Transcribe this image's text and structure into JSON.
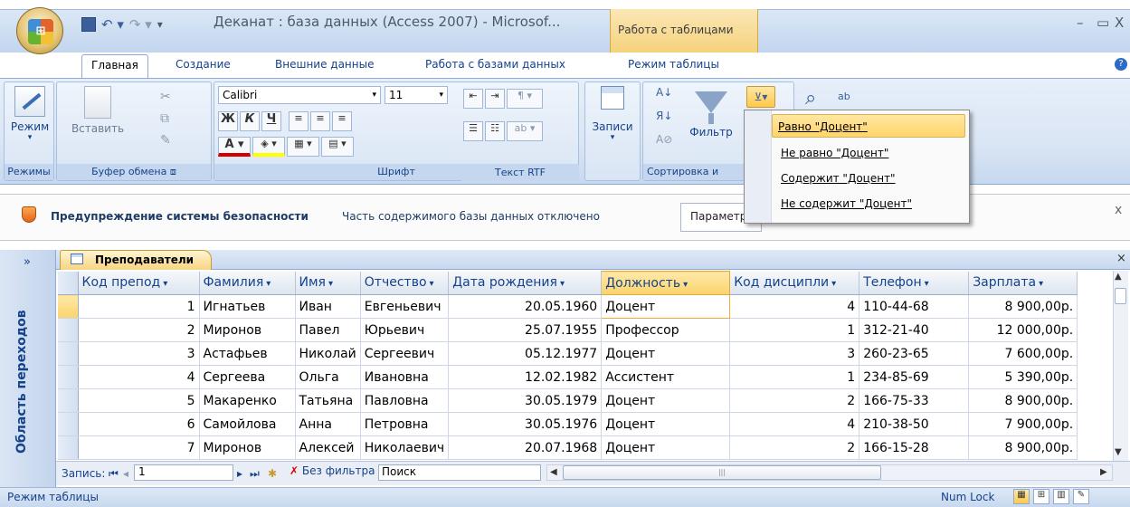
{
  "window": {
    "title": "Деканат : база данных (Access 2007) - Microsof...",
    "context_tab": "Работа с таблицами",
    "controls": [
      "–",
      "▭",
      "X"
    ],
    "office_logo": "office-button-icon"
  },
  "tabs": [
    "Главная",
    "Создание",
    "Внешние данные",
    "Работа с базами данных",
    "Режим таблицы"
  ],
  "ribbon": {
    "groups": {
      "modes": {
        "label": "Режимы",
        "button": "Режим"
      },
      "clipboard": {
        "label": "Буфер обмена",
        "paste": "Вставить"
      },
      "font": {
        "label": "Шрифт",
        "font_name": "Calibri",
        "font_size": "11",
        "bold": "Ж",
        "italic": "К",
        "underline": "Ч"
      },
      "rtf": {
        "label": "Текст RTF"
      },
      "records": {
        "label": "Записи",
        "button": "Записи"
      },
      "sort": {
        "label": "Сортировка и",
        "filter": "Фильтр"
      }
    },
    "selection_menu": [
      "Равно \"Доцент\"",
      "Не равно \"Доцент\"",
      "Содержит \"Доцент\"",
      "Не содержит \"Доцент\""
    ]
  },
  "security": {
    "title": "Предупреждение системы безопасности",
    "message": "Часть содержимого базы данных отключено",
    "button": "Параметр"
  },
  "nav_pane": {
    "label": "Область переходов",
    "chevron": "»"
  },
  "object_tab": "Преподаватели",
  "table": {
    "headers": [
      "Код препод",
      "Фамилия",
      "Имя",
      "Отчество",
      "Дата рождения",
      "Должность",
      "Код дисципли",
      "Телефон",
      "Зарплата"
    ],
    "rows": [
      [
        "1",
        "Игнатьев",
        "Иван",
        "Евгеньевич",
        "20.05.1960",
        "Доцент",
        "4",
        "110-44-68",
        "8 900,00р."
      ],
      [
        "2",
        "Миронов",
        "Павел",
        "Юрьевич",
        "25.07.1955",
        "Профессор",
        "1",
        "312-21-40",
        "12 000,00р."
      ],
      [
        "3",
        "Астафьев",
        "Николай",
        "Сергеевич",
        "05.12.1977",
        "Доцент",
        "3",
        "260-23-65",
        "7 600,00р."
      ],
      [
        "4",
        "Сергеева",
        "Ольга",
        "Ивановна",
        "12.02.1982",
        "Ассистент",
        "1",
        "234-85-69",
        "5 390,00р."
      ],
      [
        "5",
        "Макаренко",
        "Татьяна",
        "Павловна",
        "30.05.1979",
        "Доцент",
        "2",
        "166-75-33",
        "8 900,00р."
      ],
      [
        "6",
        "Самойлова",
        "Анна",
        "Петровна",
        "30.05.1976",
        "Доцент",
        "4",
        "210-38-50",
        "7 900,00р."
      ],
      [
        "7",
        "Миронов",
        "Алексей",
        "Николаевич",
        "20.07.1968",
        "Доцент",
        "2",
        "166-15-28",
        "8 900,00р."
      ]
    ]
  },
  "record_nav": {
    "label": "Запись:",
    "current": "1",
    "no_filter": "Без фильтра",
    "search": "Поиск"
  },
  "status": {
    "mode": "Режим таблицы",
    "numlock": "Num Lock"
  },
  "colors": {
    "accent": "#15428b",
    "highlight": "#ffd46a"
  }
}
